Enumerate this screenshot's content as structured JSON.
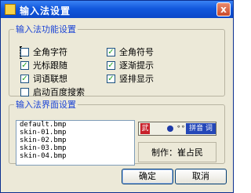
{
  "window": {
    "title": "输入法设置",
    "close_label": "x"
  },
  "function_group": {
    "legend": "输入法功能设置",
    "checkboxes": [
      {
        "label": "全角字符",
        "checked": false
      },
      {
        "label": "全角符号",
        "checked": true
      },
      {
        "label": "光标跟随",
        "checked": true
      },
      {
        "label": "逐渐提示",
        "checked": true
      },
      {
        "label": "词语联想",
        "checked": true
      },
      {
        "label": "竖排显示",
        "checked": true
      },
      {
        "label": "启动百度搜索",
        "checked": false
      }
    ]
  },
  "interface_group": {
    "legend": "输入法界面设置",
    "skins": [
      "default.bmp",
      "skin-01.bmp",
      "skin-02.bmp",
      "skin-03.bmp",
      "skin-04.bmp"
    ],
    "preview": {
      "logo": "武",
      "dots": "∘∘",
      "word": "拼音 词"
    },
    "author": "制作：崔占民"
  },
  "buttons": {
    "ok": "确定",
    "cancel": "取消"
  }
}
